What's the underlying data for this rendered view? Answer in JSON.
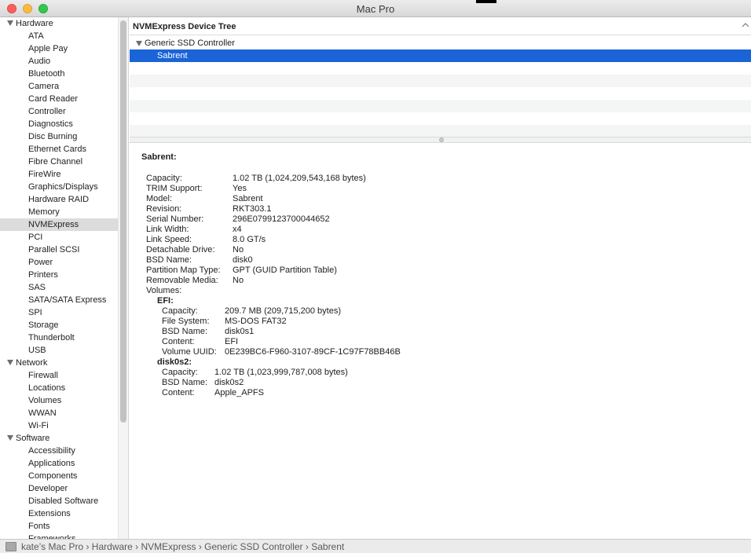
{
  "window": {
    "title": "Mac Pro"
  },
  "sidebar": {
    "groups": [
      {
        "label": "Hardware",
        "items": [
          "ATA",
          "Apple Pay",
          "Audio",
          "Bluetooth",
          "Camera",
          "Card Reader",
          "Controller",
          "Diagnostics",
          "Disc Burning",
          "Ethernet Cards",
          "Fibre Channel",
          "FireWire",
          "Graphics/Displays",
          "Hardware RAID",
          "Memory",
          "NVMExpress",
          "PCI",
          "Parallel SCSI",
          "Power",
          "Printers",
          "SAS",
          "SATA/SATA Express",
          "SPI",
          "Storage",
          "Thunderbolt",
          "USB"
        ]
      },
      {
        "label": "Network",
        "items": [
          "Firewall",
          "Locations",
          "Volumes",
          "WWAN",
          "Wi-Fi"
        ]
      },
      {
        "label": "Software",
        "items": [
          "Accessibility",
          "Applications",
          "Components",
          "Developer",
          "Disabled Software",
          "Extensions",
          "Fonts",
          "Frameworks"
        ]
      }
    ],
    "selected": "NVMExpress"
  },
  "tree": {
    "header": "NVMExpress Device Tree",
    "controller": "Generic SSD Controller",
    "device": "Sabrent"
  },
  "detail": {
    "title": "Sabrent:",
    "fields": [
      {
        "k": "Capacity:",
        "v": "1.02 TB (1,024,209,543,168 bytes)"
      },
      {
        "k": "TRIM Support:",
        "v": "Yes"
      },
      {
        "k": "Model:",
        "v": "Sabrent"
      },
      {
        "k": "Revision:",
        "v": "RKT303.1"
      },
      {
        "k": "Serial Number:",
        "v": "296E0799123700044652"
      },
      {
        "k": "Link Width:",
        "v": "x4"
      },
      {
        "k": "Link Speed:",
        "v": "8.0 GT/s"
      },
      {
        "k": "Detachable Drive:",
        "v": "No"
      },
      {
        "k": "BSD Name:",
        "v": "disk0"
      },
      {
        "k": "Partition Map Type:",
        "v": "GPT (GUID Partition Table)"
      },
      {
        "k": "Removable Media:",
        "v": "No"
      },
      {
        "k": "Volumes:",
        "v": ""
      }
    ],
    "volumes": [
      {
        "name": "EFI:",
        "fields": [
          {
            "k": "Capacity:",
            "v": "209.7 MB (209,715,200 bytes)"
          },
          {
            "k": "File System:",
            "v": "MS-DOS FAT32"
          },
          {
            "k": "BSD Name:",
            "v": "disk0s1"
          },
          {
            "k": "Content:",
            "v": "EFI"
          },
          {
            "k": "Volume UUID:",
            "v": "0E239BC6-F960-3107-89CF-1C97F78BB46B"
          }
        ]
      },
      {
        "name": "disk0s2:",
        "fields": [
          {
            "k": "Capacity:",
            "v": "1.02 TB (1,023,999,787,008 bytes)"
          },
          {
            "k": "BSD Name:",
            "v": "disk0s2"
          },
          {
            "k": "Content:",
            "v": "Apple_APFS"
          }
        ]
      }
    ]
  },
  "statusbar": {
    "path": "kate’s Mac Pro › Hardware › NVMExpress › Generic SSD Controller › Sabrent"
  }
}
